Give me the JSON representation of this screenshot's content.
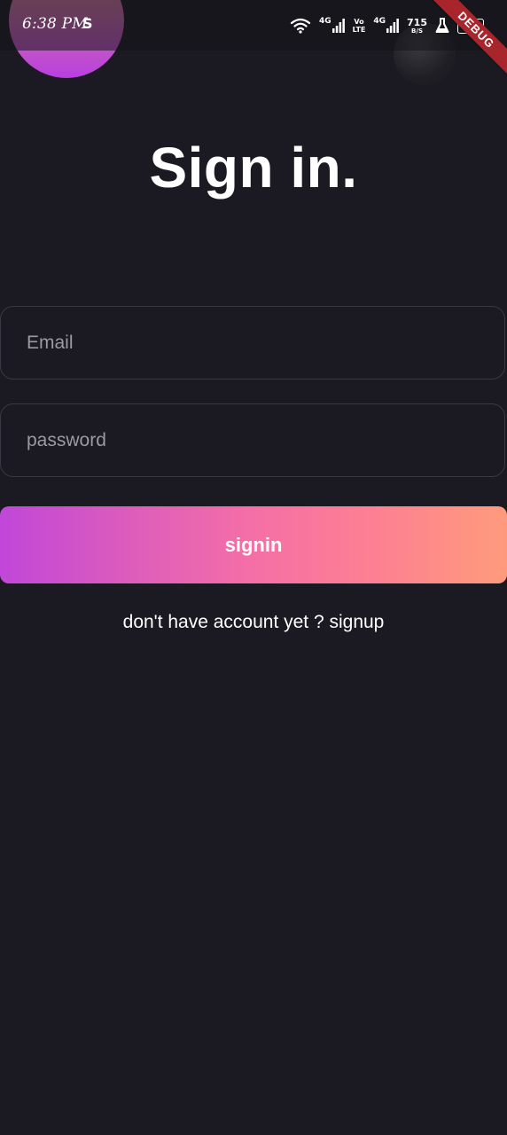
{
  "status_bar": {
    "time": "6:38 PM",
    "app_icon": "S",
    "network_1": "4G",
    "volte_top": "Vo",
    "volte_bottom": "LTE",
    "network_2": "4G",
    "speed_value": "715",
    "speed_unit": "B/S",
    "battery": "100"
  },
  "debug_banner": "DEBUG",
  "title": "Sign in.",
  "form": {
    "email_placeholder": "Email",
    "password_placeholder": "password",
    "signin_label": "signin",
    "signup_prompt": "don't have account yet ? signup"
  },
  "colors": {
    "background": "#1b1a22",
    "field_border": "#393944",
    "gradient_start": "#c047d9",
    "gradient_end": "#fe9b7c",
    "debug_ribbon": "#a8252c"
  },
  "icons": [
    "wifi-icon",
    "signal-icon",
    "lab-flask-icon",
    "battery-icon"
  ]
}
